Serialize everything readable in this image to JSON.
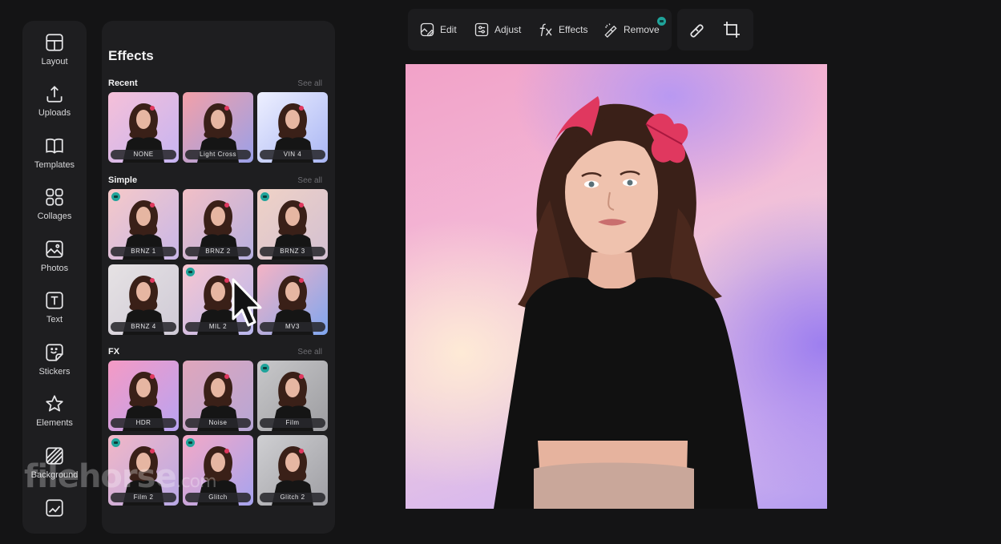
{
  "sidebar": {
    "items": [
      {
        "label": "Layout",
        "icon": "layout-icon"
      },
      {
        "label": "Uploads",
        "icon": "upload-icon"
      },
      {
        "label": "Templates",
        "icon": "book-icon"
      },
      {
        "label": "Collages",
        "icon": "grid-icon"
      },
      {
        "label": "Photos",
        "icon": "image-icon"
      },
      {
        "label": "Text",
        "icon": "text-icon"
      },
      {
        "label": "Stickers",
        "icon": "sticker-icon"
      },
      {
        "label": "Elements",
        "icon": "star-icon"
      },
      {
        "label": "Background",
        "icon": "pattern-icon"
      }
    ]
  },
  "effects_panel": {
    "title": "Effects",
    "sections": [
      {
        "title": "Recent",
        "see_all": "See all",
        "items": [
          {
            "label": "NONE",
            "premium": false,
            "bg": [
              "#f6c0d8",
              "#c6b4f2"
            ]
          },
          {
            "label": "Light Cross",
            "premium": false,
            "bg": [
              "#f3a0a8",
              "#9aa0e8"
            ]
          },
          {
            "label": "VIN 4",
            "premium": false,
            "bg": [
              "#eef0ff",
              "#a9b6f4"
            ]
          }
        ]
      },
      {
        "title": "Simple",
        "see_all": "See all",
        "items": [
          {
            "label": "BRNZ 1",
            "premium": true,
            "bg": [
              "#f6c9c8",
              "#c8b6e8"
            ]
          },
          {
            "label": "BRNZ 2",
            "premium": false,
            "bg": [
              "#f2bfc6",
              "#b7b0e0"
            ]
          },
          {
            "label": "BRNZ 3",
            "premium": true,
            "bg": [
              "#f0d2c6",
              "#d3c0d2"
            ]
          },
          {
            "label": "BRNZ 4",
            "premium": false,
            "bg": [
              "#e6e2e4",
              "#cfcad6"
            ]
          },
          {
            "label": "MIL 2",
            "premium": true,
            "bg": [
              "#f7c6d0",
              "#b9b7ee"
            ]
          },
          {
            "label": "MV3",
            "premium": false,
            "bg": [
              "#f5b3c4",
              "#7fa6ef"
            ]
          }
        ]
      },
      {
        "title": "FX",
        "see_all": "See all",
        "items": [
          {
            "label": "HDR",
            "premium": false,
            "bg": [
              "#f59ac4",
              "#b9a3f2"
            ]
          },
          {
            "label": "Noise",
            "premium": false,
            "bg": [
              "#e0a6bb",
              "#b6a6d6"
            ]
          },
          {
            "label": "Film",
            "premium": true,
            "bg": [
              "#c8c8ca",
              "#9c9ca0"
            ]
          },
          {
            "label": "Film 2",
            "premium": true,
            "bg": [
              "#f2b7c6",
              "#b8a8e6"
            ]
          },
          {
            "label": "Glitch",
            "premium": true,
            "bg": [
              "#f4a9c6",
              "#a6a3ef"
            ]
          },
          {
            "label": "Glitch 2",
            "premium": false,
            "bg": [
              "#cfcfd2",
              "#9e9ea3"
            ]
          }
        ]
      }
    ]
  },
  "toolbar": {
    "tools": [
      {
        "label": "Edit",
        "icon": "edit-image-icon"
      },
      {
        "label": "Adjust",
        "icon": "adjust-sliders-icon"
      },
      {
        "label": "Effects",
        "icon": "fx-icon"
      },
      {
        "label": "Remove",
        "icon": "magic-eraser-icon",
        "premium": true
      }
    ],
    "extra": [
      {
        "icon": "eraser-icon"
      },
      {
        "icon": "crop-icon"
      }
    ]
  },
  "watermark": {
    "brand": "filehorse",
    "tld": ".com"
  },
  "colors": {
    "panel_bg": "#1e1e20",
    "page_bg": "#141415",
    "premium_badge": "#1fa39a"
  }
}
